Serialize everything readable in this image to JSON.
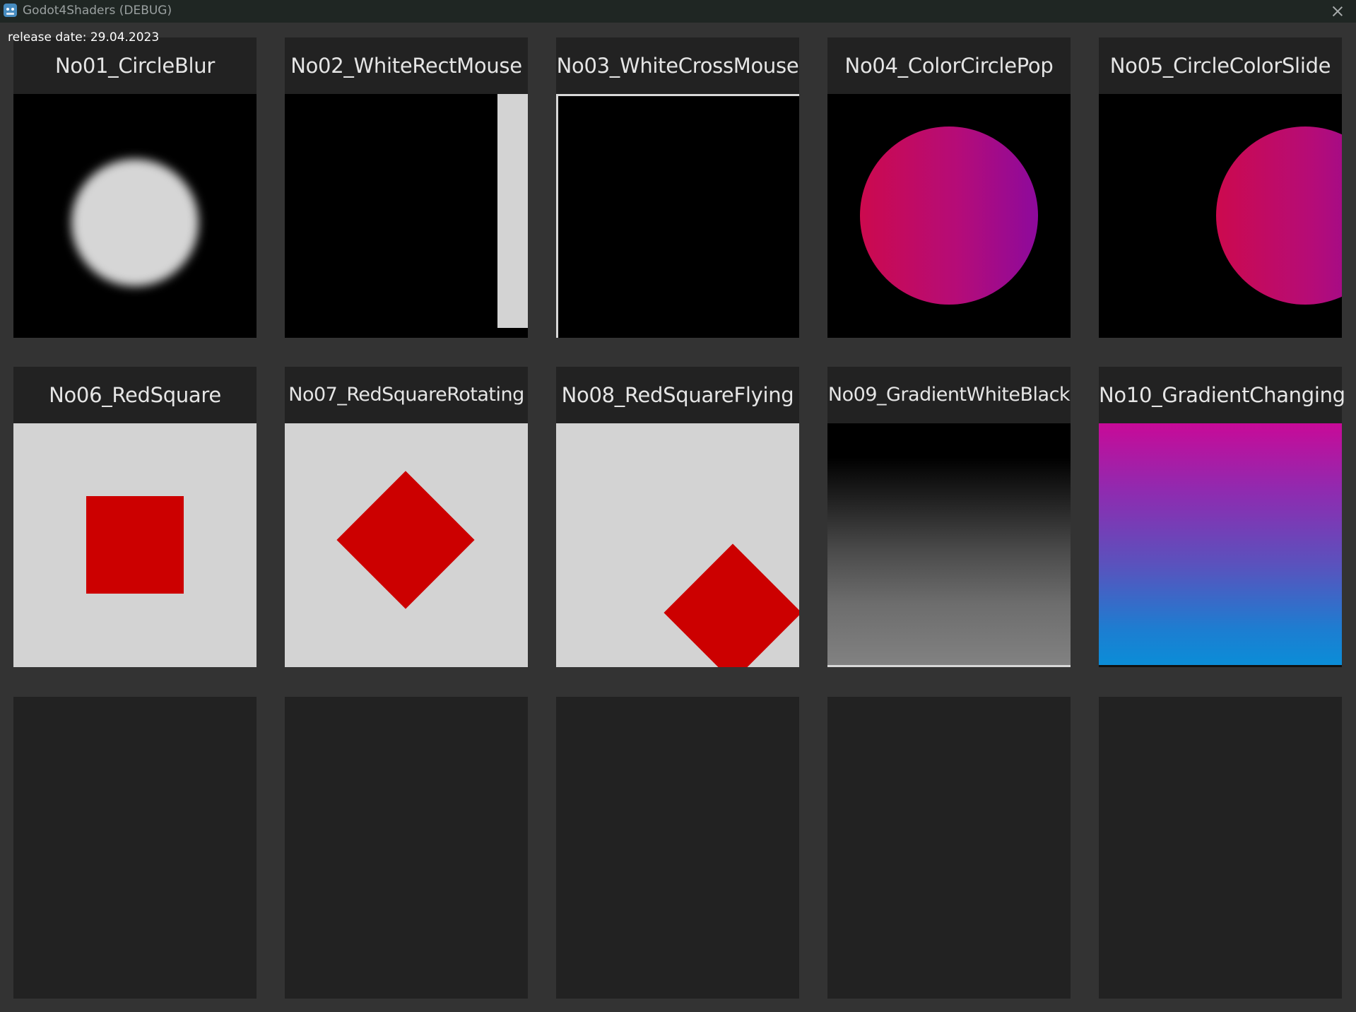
{
  "window": {
    "title": "Godot4Shaders (DEBUG)",
    "icon": "godot-icon"
  },
  "release_date": "release date: 29.04.2023",
  "colors": {
    "background": "#333333",
    "card": "#222222",
    "titlebar": "#1f2623",
    "red": "#cc0000",
    "light_gray": "#d3d3d3"
  },
  "shaders": [
    {
      "label": "No01_CircleBlur"
    },
    {
      "label": "No02_WhiteRectMouse"
    },
    {
      "label": "No03_WhiteCrossMouse"
    },
    {
      "label": "No04_ColorCirclePop"
    },
    {
      "label": "No05_CircleColorSlide"
    },
    {
      "label": "No06_RedSquare"
    },
    {
      "label": "No07_RedSquareRotating"
    },
    {
      "label": "No08_RedSquareFlying"
    },
    {
      "label": "No09_GradientWhiteBlack"
    },
    {
      "label": "No10_GradientChanging"
    }
  ],
  "empty_slots": 5
}
